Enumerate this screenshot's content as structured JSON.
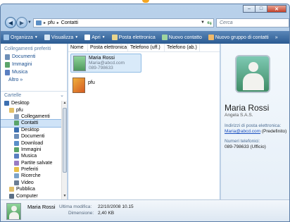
{
  "window": {
    "title": ""
  },
  "address": {
    "path": [
      "pfu",
      "Contatti"
    ],
    "search_placeholder": "Cerca"
  },
  "toolbar": {
    "items": [
      {
        "label": "Organizza",
        "dropdown": true,
        "icon": "organize-icon",
        "color": "#9fc3e8"
      },
      {
        "label": "Visualizza",
        "dropdown": true,
        "icon": "views-icon",
        "color": "#d8e6f3"
      },
      {
        "label": "Apri",
        "dropdown": true,
        "icon": "open-icon",
        "color": "#ffffff"
      },
      {
        "label": "Posta elettronica",
        "dropdown": false,
        "icon": "email-icon",
        "color": "#e9d58d"
      },
      {
        "label": "Nuovo contatto",
        "dropdown": false,
        "icon": "new-contact-icon",
        "color": "#9fd49f"
      },
      {
        "label": "Nuovo gruppo di contatti",
        "dropdown": false,
        "icon": "new-group-icon",
        "color": "#f0b96a"
      },
      {
        "label": "»",
        "dropdown": false,
        "icon": "",
        "color": ""
      }
    ]
  },
  "nav": {
    "favorites_header": "Collegamenti preferiti",
    "favorites": [
      {
        "label": "Documenti",
        "icon": "documents-icon",
        "color": "#6d8fb8"
      },
      {
        "label": "Immagini",
        "icon": "pictures-icon",
        "color": "#5aa46a"
      },
      {
        "label": "Musica",
        "icon": "music-icon",
        "color": "#5a7fc1"
      }
    ],
    "more": "Altro  »",
    "folders_header": "Cartelle",
    "tree": [
      {
        "label": "Desktop",
        "indent": 0,
        "icon": "desktop-icon",
        "color": "#3c6fb0",
        "selected": false
      },
      {
        "label": "pfu",
        "indent": 1,
        "icon": "user-folder-icon",
        "color": "#e2c06a",
        "selected": false
      },
      {
        "label": "Collegamenti",
        "indent": 2,
        "icon": "links-icon",
        "color": "#8aa2bf",
        "selected": false
      },
      {
        "label": "Contatti",
        "indent": 2,
        "icon": "contacts-icon",
        "color": "#5aa46a",
        "selected": true
      },
      {
        "label": "Desktop",
        "indent": 2,
        "icon": "desktop-icon",
        "color": "#3c6fb0",
        "selected": false
      },
      {
        "label": "Documenti",
        "indent": 2,
        "icon": "documents-icon",
        "color": "#6d8fb8",
        "selected": false
      },
      {
        "label": "Download",
        "indent": 2,
        "icon": "download-icon",
        "color": "#5a8fc9",
        "selected": false
      },
      {
        "label": "Immagini",
        "indent": 2,
        "icon": "pictures-icon",
        "color": "#5aa46a",
        "selected": false
      },
      {
        "label": "Musica",
        "indent": 2,
        "icon": "music-icon",
        "color": "#5a7fc1",
        "selected": false
      },
      {
        "label": "Partite salvate",
        "indent": 2,
        "icon": "saved-games-icon",
        "color": "#9a7bc4",
        "selected": false
      },
      {
        "label": "Preferiti",
        "indent": 2,
        "icon": "favorites-icon",
        "color": "#e8c04a",
        "selected": false
      },
      {
        "label": "Ricerche",
        "indent": 2,
        "icon": "searches-icon",
        "color": "#7ca3c9",
        "selected": false
      },
      {
        "label": "Video",
        "indent": 2,
        "icon": "videos-icon",
        "color": "#6b7d94",
        "selected": false
      },
      {
        "label": "Pubblica",
        "indent": 1,
        "icon": "public-folder-icon",
        "color": "#e2c06a",
        "selected": false
      },
      {
        "label": "Computer",
        "indent": 1,
        "icon": "computer-icon",
        "color": "#5b6f86",
        "selected": false
      }
    ]
  },
  "list": {
    "columns": [
      "Nome",
      "Posta elettronica",
      "Telefono (uff.)",
      "Telefono (ab.)"
    ],
    "items": [
      {
        "name": "Maria Rossi",
        "email": "Maria@abcd.com",
        "phone": "089-798633",
        "type": "contact"
      },
      {
        "name": "pfu",
        "type": "group"
      }
    ]
  },
  "preview": {
    "name": "Maria Rossi",
    "company": "Angela S.A.S.",
    "email_label": "Indirizzi di posta elettronica:",
    "email": "Maria@abcd.com",
    "email_suffix": " (Predefinito)",
    "phone_label": "Numeri telefonici:",
    "phone": "089-798633 (Ufficio)"
  },
  "details": {
    "name": "Maria Rossi",
    "modified_label": "Ultima modifica:",
    "modified_value": "22/10/2008 10.15",
    "size_label": "Dimensione:",
    "size_value": "2,40 KB"
  }
}
